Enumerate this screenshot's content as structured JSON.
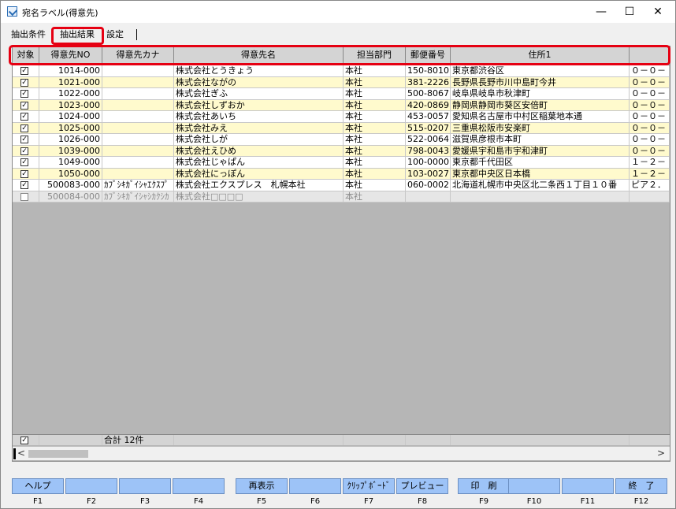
{
  "window": {
    "title": "宛名ラベル(得意先)",
    "minimize": "—",
    "maximize": "☐",
    "close": "✕"
  },
  "tabs": [
    "抽出条件",
    "抽出結果",
    "設定"
  ],
  "columns": [
    "対象",
    "得意先NO",
    "得意先カナ",
    "得意先名",
    "担当部門",
    "郵便番号",
    "住所1",
    ""
  ],
  "rows": [
    {
      "checked": true,
      "no": "1014-000",
      "kana": "",
      "name": "株式会社とうきょう",
      "dept": "本社",
      "zip": "150-8010",
      "addr1": "東京都渋谷区",
      "addr2": "０－０－"
    },
    {
      "checked": true,
      "no": "1021-000",
      "kana": "",
      "name": "株式会社ながの",
      "dept": "本社",
      "zip": "381-2226",
      "addr1": "長野県長野市川中島町今井",
      "addr2": "０－０－"
    },
    {
      "checked": true,
      "no": "1022-000",
      "kana": "",
      "name": "株式会社ぎふ",
      "dept": "本社",
      "zip": "500-8067",
      "addr1": "岐阜県岐阜市秋津町",
      "addr2": "０－０－"
    },
    {
      "checked": true,
      "no": "1023-000",
      "kana": "",
      "name": "株式会社しずおか",
      "dept": "本社",
      "zip": "420-0869",
      "addr1": "静岡県静岡市葵区安倍町",
      "addr2": "０－０－"
    },
    {
      "checked": true,
      "no": "1024-000",
      "kana": "",
      "name": "株式会社あいち",
      "dept": "本社",
      "zip": "453-0057",
      "addr1": "愛知県名古屋市中村区稲葉地本通",
      "addr2": "０－０－"
    },
    {
      "checked": true,
      "no": "1025-000",
      "kana": "",
      "name": "株式会社みえ",
      "dept": "本社",
      "zip": "515-0207",
      "addr1": "三重県松阪市安楽町",
      "addr2": "０－０－"
    },
    {
      "checked": true,
      "no": "1026-000",
      "kana": "",
      "name": "株式会社しが",
      "dept": "本社",
      "zip": "522-0064",
      "addr1": "滋賀県彦根市本町",
      "addr2": "０－０－"
    },
    {
      "checked": true,
      "no": "1039-000",
      "kana": "",
      "name": "株式会社えひめ",
      "dept": "本社",
      "zip": "798-0043",
      "addr1": "愛媛県宇和島市宇和津町",
      "addr2": "０－０－"
    },
    {
      "checked": true,
      "no": "1049-000",
      "kana": "",
      "name": "株式会社じゃぱん",
      "dept": "本社",
      "zip": "100-0000",
      "addr1": "東京都千代田区",
      "addr2": "１－２－"
    },
    {
      "checked": true,
      "no": "1050-000",
      "kana": "",
      "name": "株式会社にっぽん",
      "dept": "本社",
      "zip": "103-0027",
      "addr1": "東京都中央区日本橋",
      "addr2": "１－２－"
    },
    {
      "checked": true,
      "no": "500083-000",
      "kana": "ｶﾌﾞｼｷｶﾞｲｼｬｴｸｽﾌﾟ",
      "name": "株式会社エクスプレス　札幌本社",
      "dept": "本社",
      "zip": "060-0002",
      "addr1": "北海道札幌市中央区北二条西１丁目１０番",
      "addr2": "ピア２．"
    },
    {
      "checked": false,
      "no": "500084-000",
      "kana": "ｶﾌﾞｼｷｶﾞｲｼｬｼｶｸｼｶ",
      "name": "株式会社□□□□",
      "dept": "本社",
      "zip": "",
      "addr1": "",
      "addr2": ""
    }
  ],
  "total": "合計 12件",
  "scroll": {
    "left": "<",
    "right": ">"
  },
  "fkeys": [
    {
      "label": "ヘルプ",
      "key": "F1"
    },
    {
      "label": "",
      "key": "F2"
    },
    {
      "label": "",
      "key": "F3"
    },
    {
      "label": "",
      "key": "F4"
    },
    {
      "label": "再表示",
      "key": "F5"
    },
    {
      "label": "",
      "key": "F6"
    },
    {
      "label": "ｸﾘｯﾌﾟﾎﾞｰﾄﾞ",
      "key": "F7"
    },
    {
      "label": "プレビュー",
      "key": "F8"
    },
    {
      "label": "印　刷",
      "key": "F9"
    },
    {
      "label": "",
      "key": "F10"
    },
    {
      "label": "",
      "key": "F11"
    },
    {
      "label": "終　了",
      "key": "F12"
    }
  ]
}
